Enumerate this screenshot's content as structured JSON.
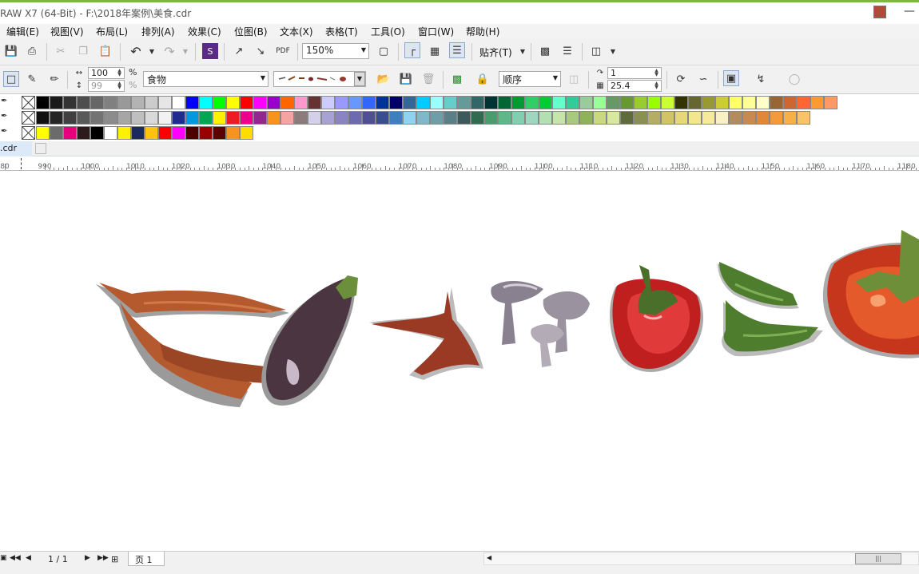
{
  "window": {
    "title": "RAW X7 (64-Bit) - F:\\2018年案例\\美食.cdr"
  },
  "menu": {
    "items": [
      "编辑(E)",
      "视图(V)",
      "布局(L)",
      "排列(A)",
      "效果(C)",
      "位图(B)",
      "文本(X)",
      "表格(T)",
      "工具(O)",
      "窗口(W)",
      "帮助(H)"
    ]
  },
  "toolbar": {
    "zoom": "150%",
    "snap_label": "贴齐(T)"
  },
  "propbar": {
    "scale_w": "100",
    "scale_h": "99",
    "pct": "%",
    "object_name": "食物",
    "order_label": "顺序",
    "nudge": "1",
    "dup_dist": "25.4"
  },
  "colors": {
    "row1": [
      "#000000",
      "#1a1a1a",
      "#333333",
      "#4d4d4d",
      "#666666",
      "#808080",
      "#999999",
      "#b3b3b3",
      "#cccccc",
      "#e6e6e6",
      "#ffffff",
      "#0000ff",
      "#00ffff",
      "#00ff00",
      "#ffff00",
      "#ff0000",
      "#ff00ff",
      "#9900cc",
      "#ff6600",
      "#ff99cc",
      "#663333",
      "#ccccff",
      "#9999ff",
      "#6699ff",
      "#3366ff",
      "#003399",
      "#000066",
      "#336699",
      "#00ccff",
      "#99ffff",
      "#66cccc",
      "#669999",
      "#336666",
      "#003333",
      "#006633",
      "#009933",
      "#33cc66",
      "#00cc33",
      "#66ffcc",
      "#33cc99",
      "#99cc99",
      "#99ff99",
      "#669966",
      "#669933",
      "#99cc33",
      "#99ff00",
      "#ccff33",
      "#333300",
      "#666633",
      "#999933",
      "#cccc33",
      "#ffff66",
      "#ffff99",
      "#ffffcc",
      "#996633",
      "#cc6633",
      "#ff6633",
      "#ff9933",
      "#ff9966"
    ],
    "row2": [
      "#111111",
      "#262626",
      "#404040",
      "#595959",
      "#737373",
      "#8c8c8c",
      "#a6a6a6",
      "#bfbfbf",
      "#d9d9d9",
      "#f2f2f2",
      "#1f2b8f",
      "#0099dd",
      "#00a651",
      "#fff200",
      "#ed1c24",
      "#ec008c",
      "#92278f",
      "#f7941d",
      "#f5a3a3",
      "#8c7b7b",
      "#d5d0ea",
      "#a8a1d6",
      "#8a84c4",
      "#6d6ab0",
      "#4f4f93",
      "#3a4d8f",
      "#3f7fbf",
      "#8fd3f4",
      "#7fb8c8",
      "#6e9ea7",
      "#5a7f86",
      "#3c5a5c",
      "#2e6b4f",
      "#4a9b6e",
      "#5fb88a",
      "#7fcfb0",
      "#9fd6c0",
      "#b3e0b3",
      "#c6e6a9",
      "#a9c97f",
      "#8fb35b",
      "#c8d97f",
      "#d9e89f",
      "#5f6b3a",
      "#8a8f52",
      "#b3ae63",
      "#d1c466",
      "#e6d87a",
      "#f2e68f",
      "#f5ea9e",
      "#f9f1c2",
      "#b38b5d",
      "#c98a52",
      "#e0873a",
      "#f29a3c",
      "#f5b04a",
      "#f7c46b"
    ],
    "row3": [
      "#ffff00",
      "#6b6b6b",
      "#e6007e",
      "#2d1a1a",
      "#000000",
      "#ffffff",
      "#fff200",
      "#1b2a5c",
      "#ffc20e",
      "#ff0000",
      "#ff00ff",
      "#4d0000",
      "#990000",
      "#5c0000",
      "#f7941d",
      "#ffdd00"
    ],
    "accent": "#7ab648"
  },
  "doc_tab": {
    "name": ".cdr"
  },
  "ruler": {
    "ticks": [
      "80",
      "990",
      "1000",
      "1010",
      "1020",
      "1030",
      "1040",
      "1050",
      "1060",
      "1070",
      "1080",
      "1090",
      "1100",
      "1110",
      "1120",
      "1130",
      "1140",
      "1150",
      "1160",
      "1170",
      "1180"
    ]
  },
  "status": {
    "page_count": "1 / 1",
    "page_tab": "页 1"
  },
  "icons": [
    "save-icon",
    "print-icon",
    "cut-icon",
    "copy-icon",
    "paste-icon",
    "undo-icon",
    "redo-icon",
    "launcher-icon",
    "import-icon",
    "export-icon",
    "pdf-icon",
    "fullscreen-icon",
    "eyedropper-icon"
  ]
}
